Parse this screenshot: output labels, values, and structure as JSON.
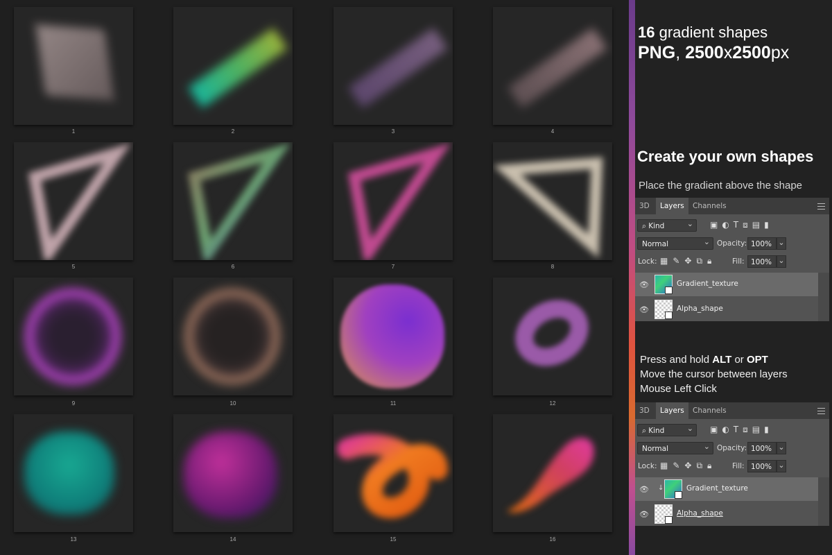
{
  "tiles": [
    {
      "number": "1"
    },
    {
      "number": "2"
    },
    {
      "number": "3"
    },
    {
      "number": "4"
    },
    {
      "number": "5"
    },
    {
      "number": "6"
    },
    {
      "number": "7"
    },
    {
      "number": "8"
    },
    {
      "number": "9"
    },
    {
      "number": "10"
    },
    {
      "number": "11"
    },
    {
      "number": "12"
    },
    {
      "number": "13"
    },
    {
      "number": "14"
    },
    {
      "number": "15"
    },
    {
      "number": "16"
    }
  ],
  "panel": {
    "headline1_num": "16",
    "headline1_text": " gradient shapes",
    "headline2_bold1": "PNG",
    "headline2_comma": ", ",
    "headline2_bold2": "2500",
    "headline2_x": "x",
    "headline2_bold3": "2500",
    "headline2_px": "px",
    "create_title": "Create your own shapes",
    "place_note": "Place the gradient above the shape",
    "step1_pre": "Press and hold ",
    "step1_alt": "ALT",
    "step1_or": " or ",
    "step1_opt": "OPT",
    "step2": "Move the cursor between layers",
    "step3": "Mouse Left Click"
  },
  "layers_panel": {
    "tab_3d": "3D",
    "tab_layers": "Layers",
    "tab_channels": "Channels",
    "kind_label": "Kind",
    "blend_mode": "Normal",
    "opacity_label": "Opacity:",
    "opacity_value": "100%",
    "lock_label": "Lock:",
    "fill_label": "Fill:",
    "fill_value": "100%",
    "layer_top": "Gradient_texture",
    "layer_bottom": "Alpha_shape"
  },
  "colors": {
    "background": "#1f1f1f",
    "tile": "#262626",
    "panel_bg": "#535353",
    "tab_bar": "#3c3c3c",
    "stripe_top": "#6a3b8a",
    "stripe_mid": "#e0533f"
  }
}
